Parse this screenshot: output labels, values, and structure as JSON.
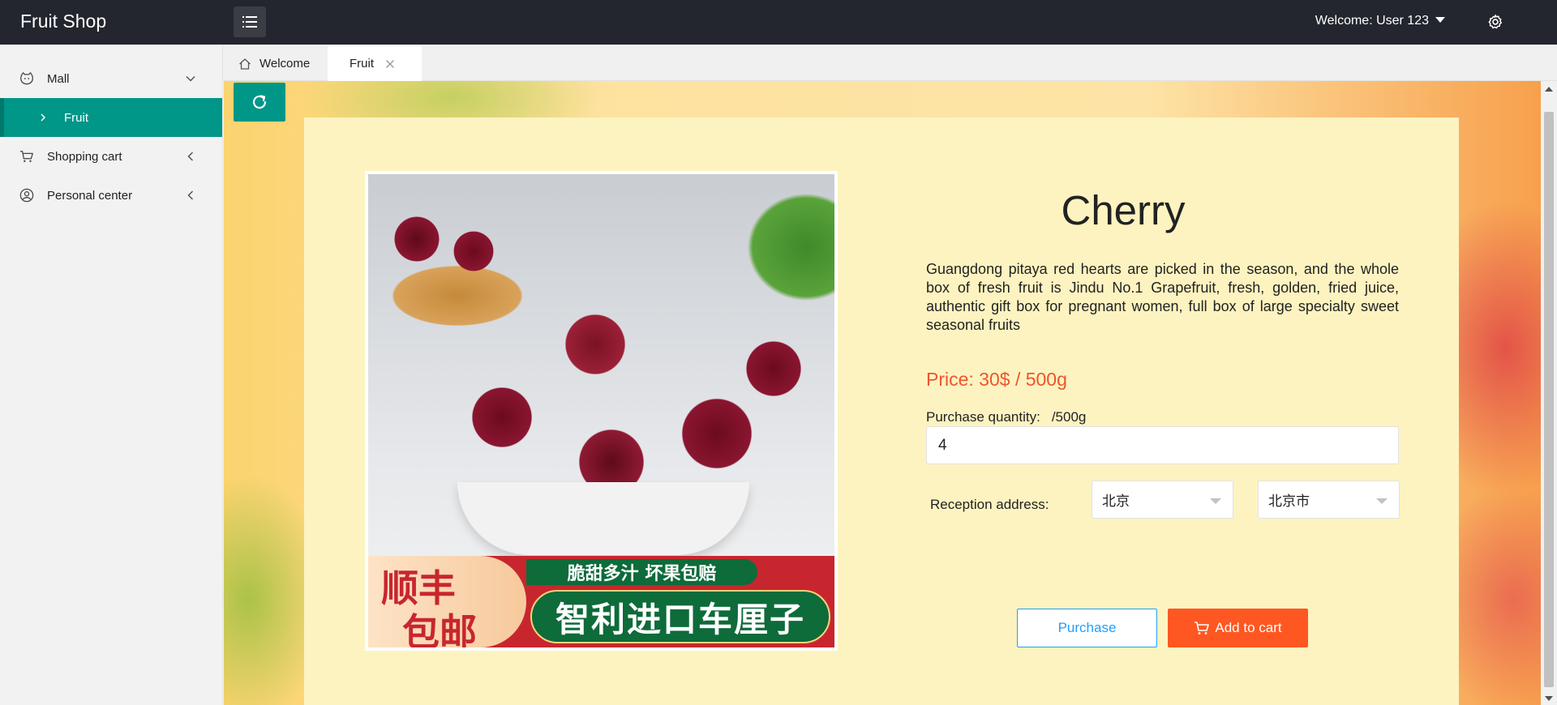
{
  "header": {
    "brand": "Fruit Shop",
    "menu_toggle_icon": "menu-icon",
    "user_label": "Welcome: User 123",
    "settings_icon": "gear-icon"
  },
  "sidebar": {
    "items": [
      {
        "label": "Mall",
        "icon": "cat-face-icon",
        "state": "expanded"
      },
      {
        "label": "Fruit",
        "icon": "chevron-right-icon",
        "state": "selected"
      },
      {
        "label": "Shopping cart",
        "icon": "cart-icon",
        "state": "collapsed"
      },
      {
        "label": "Personal center",
        "icon": "user-circle-icon",
        "state": "collapsed"
      }
    ],
    "active_color": "#009688"
  },
  "tabs": {
    "items": [
      {
        "label": "Welcome",
        "icon": "home-icon"
      },
      {
        "label": "Fruit",
        "close_icon": "close-icon"
      }
    ]
  },
  "product": {
    "title": "Cherry",
    "description": "Guangdong pitaya red hearts are picked in the season, and the whole box of fresh fruit is Jindu No.1 Grapefruit, fresh, golden, fried juice, authentic gift box for pregnant women, full box of large specialty sweet seasonal fruits",
    "price": "Price: 30$ / 500g",
    "image_banner": {
      "left_line1": "顺丰",
      "left_line2": "包邮",
      "top_pill": "脆甜多汁 坏果包赔",
      "main_pill": "智利进口车厘子"
    }
  },
  "form": {
    "qty_label": "Purchase quantity:",
    "qty_unit": "/500g",
    "qty_value": "4",
    "address_label": "Reception address:",
    "province": "北京",
    "city": "北京市"
  },
  "actions": {
    "purchase": "Purchase",
    "add_to_cart": "Add to cart"
  },
  "colors": {
    "header_bg": "#23262e",
    "accent": "#009688",
    "price": "#f0542d",
    "cart_button": "#ff5722",
    "purchase_border": "#1e9fff",
    "panel_bg": "#fdf3c0"
  }
}
